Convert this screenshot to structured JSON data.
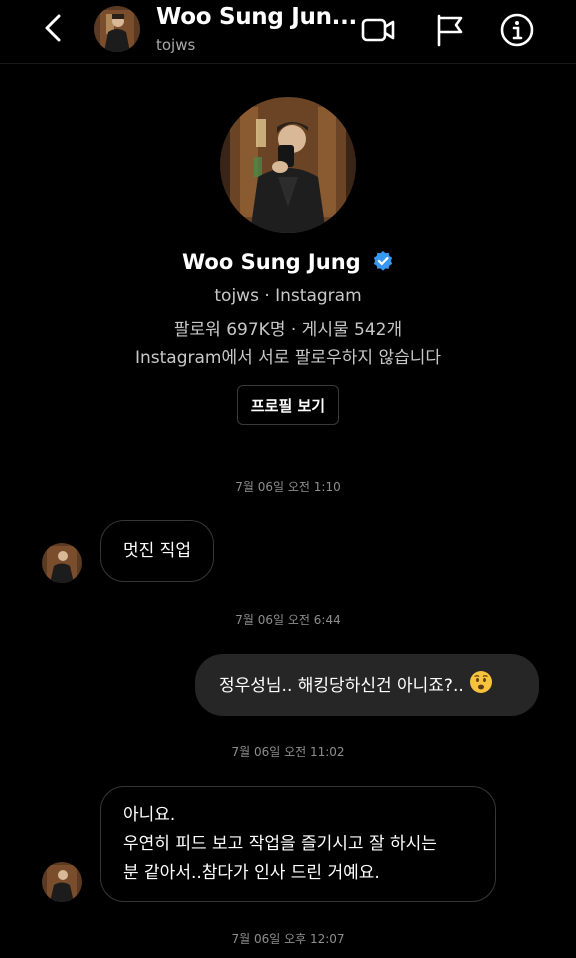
{
  "header": {
    "name": "Woo Sung Jun...",
    "username": "tojws"
  },
  "profile": {
    "name": "Woo Sung Jung",
    "subtitle": "tojws · Instagram",
    "stats": "팔로워 697K명 · 게시물 542개",
    "mutual": "Instagram에서 서로 팔로우하지 않습니다",
    "view_button": "프로필 보기"
  },
  "messages": [
    {
      "type": "timestamp",
      "text": "7월 06일 오전 1:10"
    },
    {
      "type": "incoming",
      "text": "멋진 직업"
    },
    {
      "type": "timestamp",
      "text": "7월 06일 오전 6:44"
    },
    {
      "type": "outgoing",
      "text": "정우성님.. 해킹당하신건 아니죠?..",
      "emoji": "😟"
    },
    {
      "type": "timestamp",
      "text": "7월 06일 오전 11:02"
    },
    {
      "type": "incoming",
      "lines": [
        "아니요.",
        "우연히 피드 보고 작업을 즐기시고 잘 하시는",
        "분 같아서..참다가 인사 드린 거예요."
      ]
    },
    {
      "type": "timestamp",
      "text": "7월 06일 오후 12:07"
    }
  ],
  "colors": {
    "background": "#000000",
    "outgoing_bubble": "#262626",
    "incoming_border": "#363636",
    "muted_text": "#8e8e8e",
    "verified_badge": "#3897f0"
  },
  "icons": [
    "back-chevron-icon",
    "video-call-icon",
    "report-flag-icon",
    "info-icon",
    "verified-badge-icon",
    "worried-face-emoji"
  ]
}
